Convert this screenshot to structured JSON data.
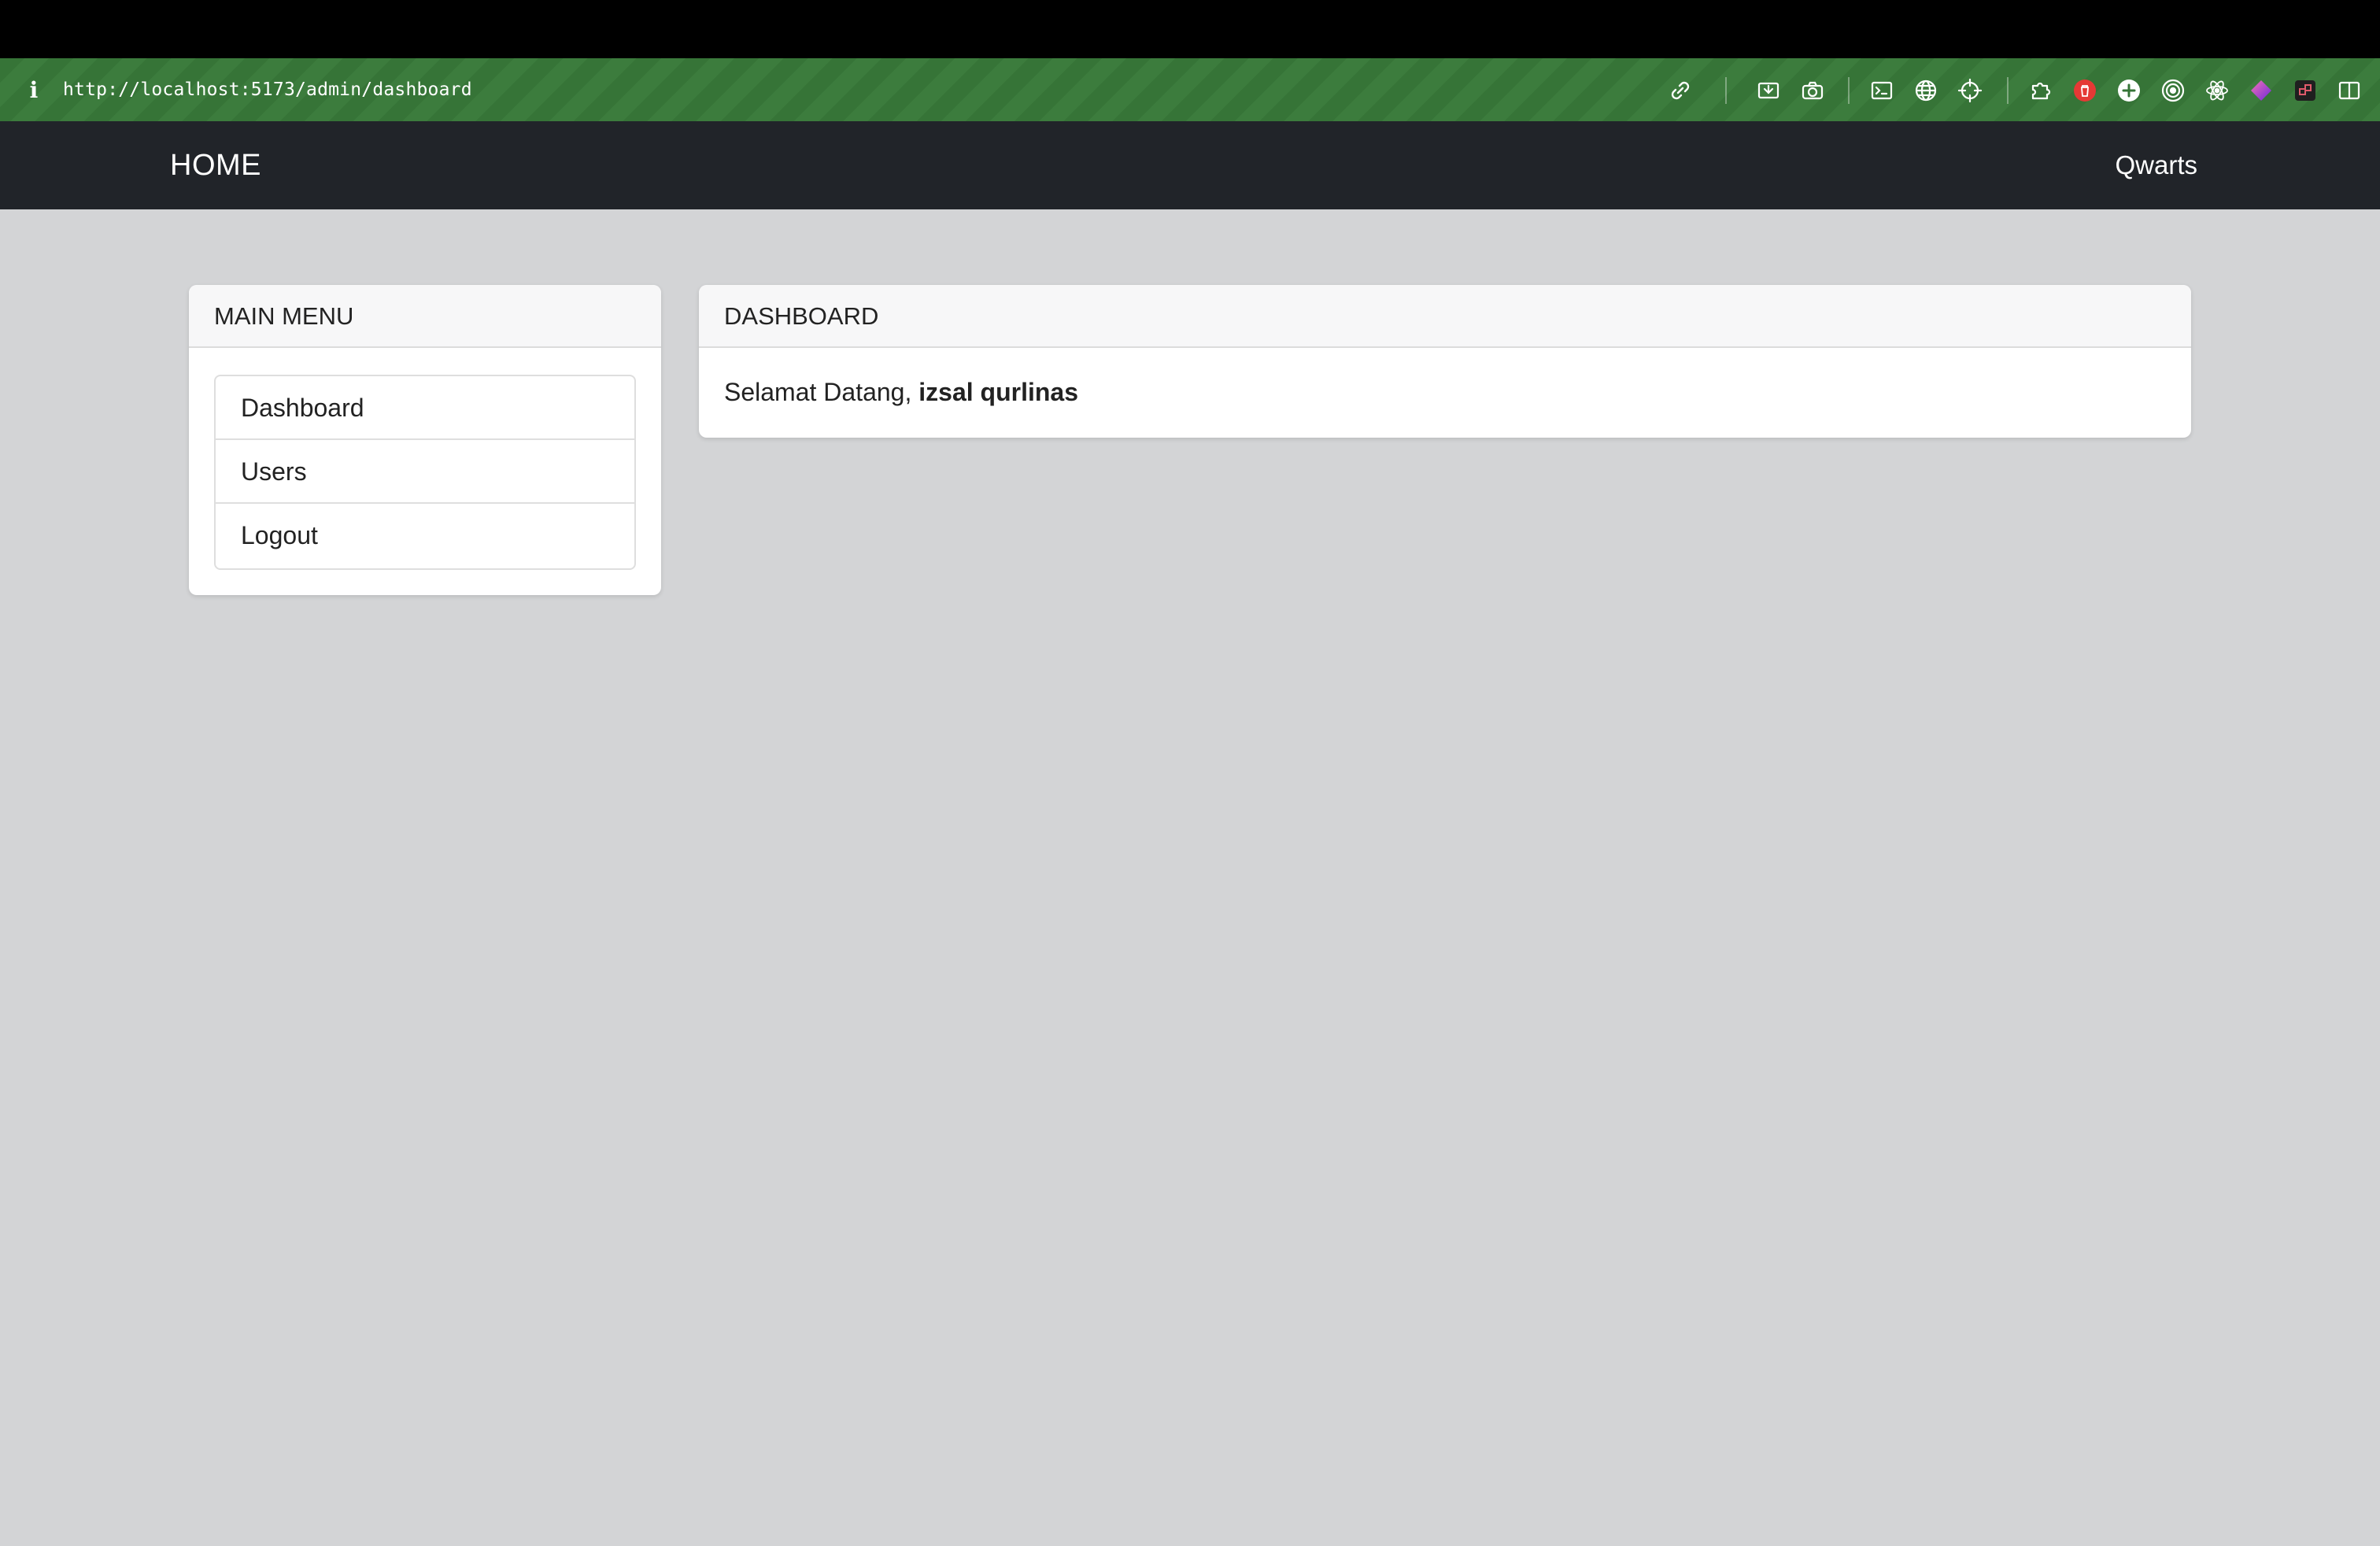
{
  "browser": {
    "url": "http://localhost:5173/admin/dashboard",
    "info_icon": "info-icon",
    "tools": [
      {
        "name": "link-icon"
      },
      {
        "name": "screenshot-area-icon"
      },
      {
        "name": "camera-icon"
      },
      {
        "name": "terminal-icon"
      },
      {
        "name": "globe-icon"
      },
      {
        "name": "crosshair-icon"
      },
      {
        "name": "puzzle-extension-icon"
      },
      {
        "name": "red-trash-extension-icon",
        "color": "#e53935"
      },
      {
        "name": "add-circle-icon"
      },
      {
        "name": "target-circle-icon"
      },
      {
        "name": "react-atom-icon"
      },
      {
        "name": "purple-diamond-extension-icon",
        "color": "#8b5cf6"
      },
      {
        "name": "dark-square-extension-icon"
      },
      {
        "name": "split-view-icon"
      }
    ],
    "bar_color": "#367437"
  },
  "navbar": {
    "home_label": "HOME",
    "brand_label": "Qwarts",
    "background": "#212429"
  },
  "sidebar": {
    "title": "MAIN MENU",
    "items": [
      {
        "label": "Dashboard"
      },
      {
        "label": "Users"
      },
      {
        "label": "Logout"
      }
    ]
  },
  "main": {
    "title": "DASHBOARD",
    "welcome_prefix": "Selamat Datang, ",
    "user_name": "izsal qurlinas"
  }
}
